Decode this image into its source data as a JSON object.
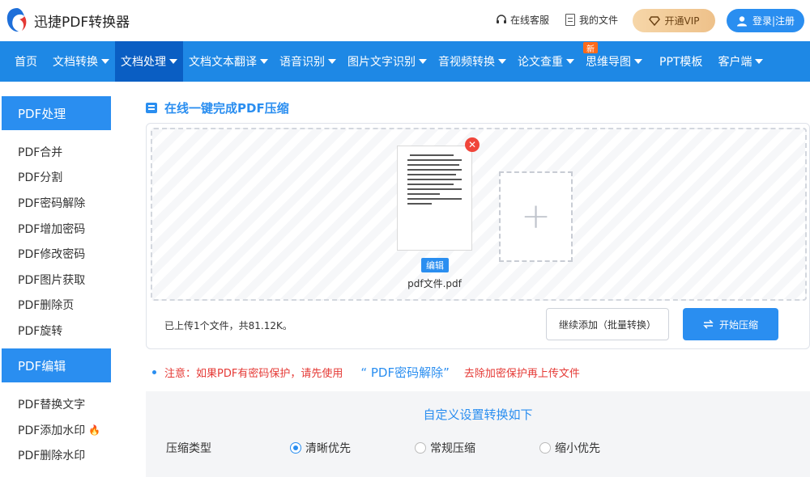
{
  "header": {
    "brand": "迅捷PDF转换器",
    "service_label": "在线客服",
    "files_label": "我的文件",
    "vip_label": "开通VIP",
    "login_label": "登录|注册"
  },
  "nav": {
    "items": [
      {
        "label": "首页",
        "dropdown": false
      },
      {
        "label": "文档转换",
        "dropdown": true
      },
      {
        "label": "文档处理",
        "dropdown": true,
        "active": true
      },
      {
        "label": "文档文本翻译",
        "dropdown": true
      },
      {
        "label": "语音识别",
        "dropdown": true
      },
      {
        "label": "图片文字识别",
        "dropdown": true
      },
      {
        "label": "音视频转换",
        "dropdown": true
      },
      {
        "label": "论文查重",
        "dropdown": true
      },
      {
        "label": "思维导图",
        "dropdown": true
      },
      {
        "label": "PPT模板",
        "dropdown": false
      },
      {
        "label": "客户端",
        "dropdown": true
      }
    ],
    "new_badge": "新"
  },
  "sidebar": {
    "section1": "PDF处理",
    "items1": [
      "PDF合并",
      "PDF分割",
      "PDF密码解除",
      "PDF增加密码",
      "PDF修改密码",
      "PDF图片获取",
      "PDF删除页",
      "PDF旋转"
    ],
    "section2": "PDF编辑",
    "items2": [
      "PDF替换文字",
      "PDF添加水印",
      "PDF删除水印"
    ]
  },
  "main": {
    "title": "在线一键完成PDF压缩",
    "file_name": "pdf文件.pdf",
    "edit_label": "编辑",
    "upload_info": "已上传1个文件，共81.12K。",
    "continue_label": "继续添加（批量转换）",
    "start_label": "开始压缩",
    "notice_prefix": "注意：如果PDF有密码保护，请先使用",
    "notice_link": "“ PDF密码解除”",
    "notice_suffix": "去除加密保护再上传文件"
  },
  "settings": {
    "title": "自定义设置转换如下",
    "option_label": "压缩类型",
    "options": [
      "清晰优先",
      "常规压缩",
      "缩小优先"
    ],
    "selected": "清晰优先"
  },
  "colors": {
    "primary": "#2a8ef0",
    "nav_bg": "#1e88e5",
    "nav_active": "#0a5ec3",
    "warning": "#e53935",
    "vip_gold": "#eec18a"
  }
}
